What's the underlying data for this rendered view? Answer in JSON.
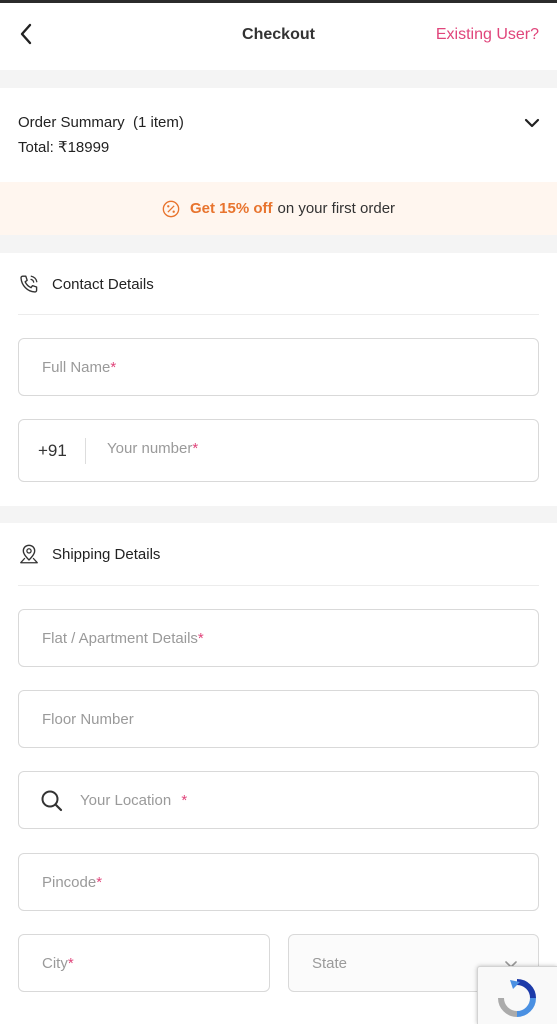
{
  "header": {
    "title": "Checkout",
    "existing_user": "Existing User?"
  },
  "summary": {
    "title": "Order Summary  (1 item)",
    "total": "Total: ₹18999"
  },
  "offer": {
    "highlight": "Get 15% off",
    "rest": "on your first order"
  },
  "contact": {
    "heading": "Contact Details",
    "full_name_placeholder": "Full Name",
    "country_code": "+91",
    "phone_placeholder": "Your number"
  },
  "shipping": {
    "heading": "Shipping Details",
    "flat_placeholder": "Flat / Apartment Details",
    "floor_placeholder": "Floor Number",
    "location_placeholder": "Your Location",
    "pincode_placeholder": "Pincode",
    "city_placeholder": "City",
    "state_placeholder": "State"
  },
  "required_mark": "*",
  "colors": {
    "accent_pink": "#e0457b",
    "offer_orange": "#e8742e",
    "offer_bg": "#fff6ef"
  },
  "icons": [
    "back-arrow-icon",
    "chevron-down-icon",
    "percent-badge-icon",
    "phone-icon",
    "location-pin-icon",
    "search-icon",
    "dropdown-caret-icon",
    "recaptcha-icon"
  ]
}
